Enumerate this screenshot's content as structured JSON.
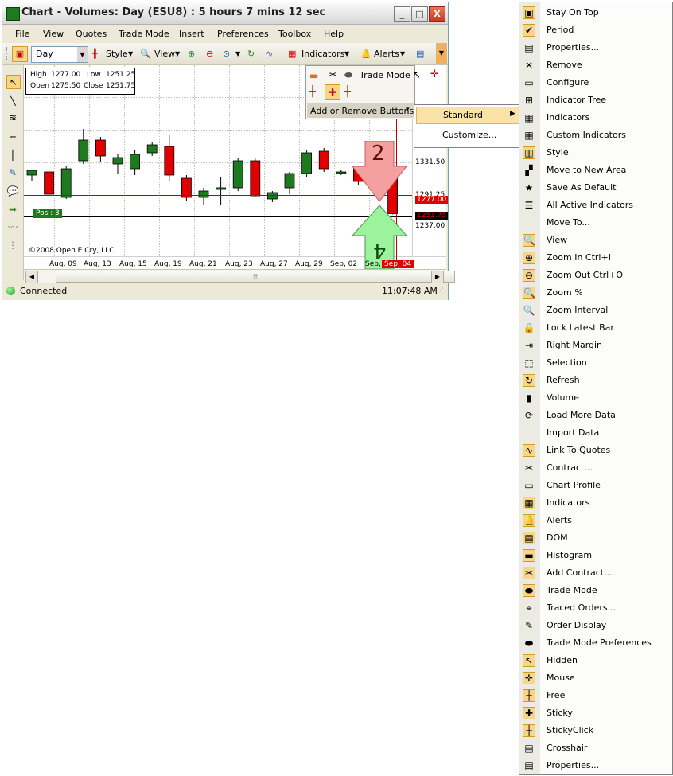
{
  "window": {
    "title": "Chart - Volumes: Day (ESU8) : 5 hours 7 mins 12 sec",
    "controls": [
      "_",
      "□",
      "X"
    ]
  },
  "menubar": [
    "File",
    "View",
    "Quotes",
    "Trade Mode",
    "Insert",
    "Preferences",
    "Toolbox",
    "Help"
  ],
  "toolbar": {
    "period": "Day",
    "style": "Style",
    "view": "View",
    "indicators": "Indicators",
    "alerts": "Alerts"
  },
  "ohlc": {
    "high_label": "High",
    "high": "1277.00",
    "low_label": "Low",
    "low": "1251.25",
    "open_label": "Open",
    "open": "1275.50",
    "close_label": "Close",
    "close": "1251.75"
  },
  "popup": {
    "trade_mode": "Trade Mode",
    "add_remove": "Add or Remove Buttons",
    "arrow": "▾"
  },
  "standard_menu": {
    "standard": "Standard",
    "customize": "Customize..."
  },
  "chart_data": {
    "type": "candlestick",
    "x_ticks": [
      "Aug, 09",
      "Aug, 13",
      "Aug, 15",
      "Aug, 19",
      "Aug, 21",
      "Aug, 23",
      "Aug, 27",
      "Aug, 29",
      "Sep, 02",
      "Sep,",
      "Sep, 04"
    ],
    "y_ticks": [
      "1331.50",
      "1291.25",
      "1277.00",
      "1251.75",
      "1237.00"
    ],
    "ylim": [
      1225,
      1345
    ],
    "candles": [
      {
        "open": 1276,
        "high": 1279,
        "low": 1272,
        "close": 1279
      },
      {
        "open": 1278,
        "high": 1279,
        "low": 1262,
        "close": 1264
      },
      {
        "open": 1262,
        "high": 1282,
        "low": 1261,
        "close": 1280
      },
      {
        "open": 1285,
        "high": 1305,
        "low": 1283,
        "close": 1298
      },
      {
        "open": 1298,
        "high": 1300,
        "low": 1284,
        "close": 1288
      },
      {
        "open": 1283,
        "high": 1289,
        "low": 1277,
        "close": 1287
      },
      {
        "open": 1280,
        "high": 1292,
        "low": 1276,
        "close": 1289
      },
      {
        "open": 1290,
        "high": 1297,
        "low": 1288,
        "close": 1295
      },
      {
        "open": 1294,
        "high": 1301,
        "low": 1272,
        "close": 1276
      },
      {
        "open": 1274,
        "high": 1276,
        "low": 1260,
        "close": 1262
      },
      {
        "open": 1262,
        "high": 1268,
        "low": 1257,
        "close": 1266
      },
      {
        "open": 1267,
        "high": 1275,
        "low": 1257,
        "close": 1268
      },
      {
        "open": 1268,
        "high": 1287,
        "low": 1266,
        "close": 1285
      },
      {
        "open": 1285,
        "high": 1287,
        "low": 1262,
        "close": 1263
      },
      {
        "open": 1261,
        "high": 1266,
        "low": 1259,
        "close": 1265
      },
      {
        "open": 1268,
        "high": 1278,
        "low": 1264,
        "close": 1277
      },
      {
        "open": 1277,
        "high": 1292,
        "low": 1275,
        "close": 1290
      },
      {
        "open": 1291,
        "high": 1293,
        "low": 1278,
        "close": 1280
      },
      {
        "open": 1277,
        "high": 1279,
        "low": 1276,
        "close": 1278
      },
      {
        "open": 1280,
        "high": 1282,
        "low": 1270,
        "close": 1272
      },
      {
        "open": 1276,
        "high": 1285,
        "low": 1270,
        "close": 1275
      },
      {
        "open": 1275.5,
        "high": 1277,
        "low": 1251.25,
        "close": 1251.75
      }
    ],
    "position_label": "Pos : 3",
    "annotations": [
      "2",
      "4"
    ],
    "copyright": "©2008 Open E Cry, LLC"
  },
  "status": {
    "connection": "Connected",
    "time": "11:07:48 AM"
  },
  "context_menu": [
    {
      "label": "Stay On Top",
      "icon": "stay-on-top-icon",
      "glyph": "▣",
      "selected": true
    },
    {
      "label": "Period",
      "icon": "check-icon",
      "glyph": "✔",
      "selected": true
    },
    {
      "label": "Properties...",
      "icon": "properties-icon",
      "glyph": "▤"
    },
    {
      "label": "Remove",
      "icon": "remove-icon",
      "glyph": "✕"
    },
    {
      "label": "Configure",
      "icon": "configure-icon",
      "glyph": "▭"
    },
    {
      "label": "Indicator Tree",
      "icon": "indicator-tree-icon",
      "glyph": "⊞"
    },
    {
      "label": "Indicators",
      "icon": "indicators-icon",
      "glyph": "▦"
    },
    {
      "label": "Custom Indicators",
      "icon": "custom-indicators-icon",
      "glyph": "▦"
    },
    {
      "label": "Style",
      "icon": "style-icon",
      "glyph": "▥",
      "selected": true
    },
    {
      "label": "Move to New Area",
      "icon": "move-new-area-icon",
      "glyph": "▞"
    },
    {
      "label": "Save As Default",
      "icon": "star-icon",
      "glyph": "★"
    },
    {
      "label": "All Active Indicators",
      "icon": "list-icon",
      "glyph": "☰"
    },
    {
      "label": "Move To...",
      "icon": "blank-icon",
      "glyph": ""
    },
    {
      "label": "View",
      "icon": "view-icon",
      "glyph": "🔍",
      "selected": true
    },
    {
      "label": "Zoom In Ctrl+I",
      "icon": "zoom-in-icon",
      "glyph": "⊕",
      "selected": true
    },
    {
      "label": "Zoom Out Ctrl+O",
      "icon": "zoom-out-icon",
      "glyph": "⊖",
      "selected": true
    },
    {
      "label": "Zoom %",
      "icon": "zoom-percent-icon",
      "glyph": "🔍",
      "selected": true
    },
    {
      "label": "Zoom Interval",
      "icon": "zoom-interval-icon",
      "glyph": "🔍"
    },
    {
      "label": "Lock Latest Bar",
      "icon": "lock-icon",
      "glyph": "🔒"
    },
    {
      "label": "Right Margin",
      "icon": "right-margin-icon",
      "glyph": "⇥"
    },
    {
      "label": "Selection",
      "icon": "selection-icon",
      "glyph": "⬚"
    },
    {
      "label": "Refresh",
      "icon": "refresh-icon",
      "glyph": "↻",
      "selected": true
    },
    {
      "label": "Volume",
      "icon": "volume-icon",
      "glyph": "▮"
    },
    {
      "label": "Load More Data",
      "icon": "load-more-icon",
      "glyph": "⟳"
    },
    {
      "label": "Import Data",
      "icon": "blank-icon",
      "glyph": ""
    },
    {
      "label": "Link To Quotes",
      "icon": "link-quotes-icon",
      "glyph": "∿",
      "selected": true
    },
    {
      "label": "Contract...",
      "icon": "contract-icon",
      "glyph": "✂"
    },
    {
      "label": "Chart Profile",
      "icon": "chart-profile-icon",
      "glyph": "▭"
    },
    {
      "label": "Indicators",
      "icon": "indicators-icon",
      "glyph": "▦",
      "selected": true
    },
    {
      "label": "Alerts",
      "icon": "bell-icon",
      "glyph": "🔔",
      "selected": true
    },
    {
      "label": "DOM",
      "icon": "dom-icon",
      "glyph": "▤",
      "selected": true
    },
    {
      "label": "Histogram",
      "icon": "histogram-icon",
      "glyph": "▬",
      "selected": true
    },
    {
      "label": "Add Contract...",
      "icon": "add-contract-icon",
      "glyph": "✂",
      "selected": true
    },
    {
      "label": "Trade Mode",
      "icon": "trade-mode-icon",
      "glyph": "⬬",
      "selected": true
    },
    {
      "label": "Traced Orders...",
      "icon": "traced-orders-icon",
      "glyph": "⌖"
    },
    {
      "label": "Order Display",
      "icon": "order-display-icon",
      "glyph": "✎"
    },
    {
      "label": "Trade Mode Preferences",
      "icon": "trade-prefs-icon",
      "glyph": "⬬"
    },
    {
      "label": "Hidden",
      "icon": "cursor-icon",
      "glyph": "↖",
      "selected": true
    },
    {
      "label": "Mouse",
      "icon": "mouse-crosshair-icon",
      "glyph": "✛",
      "selected": true
    },
    {
      "label": "Free",
      "icon": "free-crosshair-icon",
      "glyph": "┼",
      "selected": true
    },
    {
      "label": "Sticky",
      "icon": "sticky-icon",
      "glyph": "✚",
      "selected": true
    },
    {
      "label": "StickyClick",
      "icon": "sticky-click-icon",
      "glyph": "┼",
      "selected": true
    },
    {
      "label": "Crosshair",
      "icon": "crosshair-icon",
      "glyph": "▤"
    },
    {
      "label": "Properties...",
      "icon": "properties-icon",
      "glyph": "▤"
    }
  ],
  "colors": {
    "bull": "#1e7a1e",
    "bear": "#e00000",
    "menu_highlight": "#fbe2a8",
    "arrow_down": "#f4a0a0",
    "arrow_up": "#9df29d"
  }
}
